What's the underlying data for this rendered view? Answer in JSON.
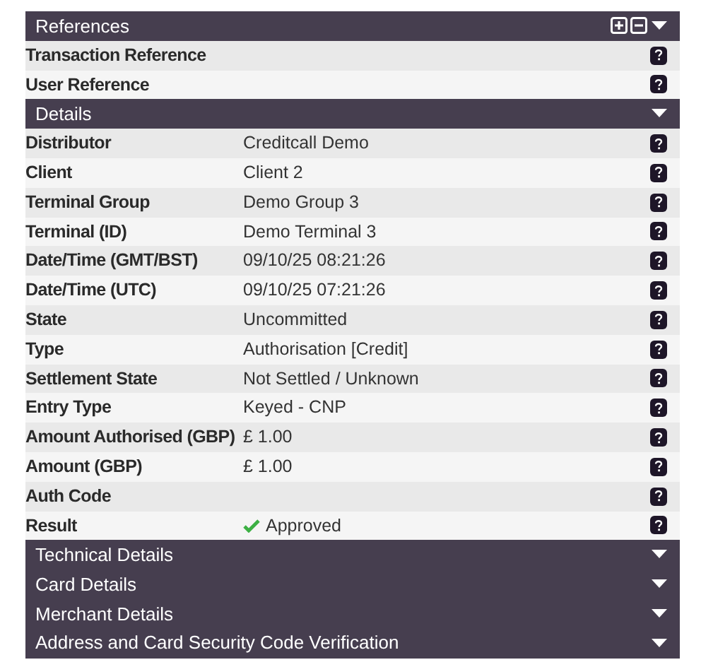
{
  "sections": [
    {
      "title": "References",
      "expanded": true,
      "expand_collapse_all": true,
      "rows": [
        {
          "label": "Transaction Reference",
          "kind": "text"
        },
        {
          "label": "User Reference",
          "kind": "text"
        }
      ]
    },
    {
      "title": "Details",
      "expanded": true,
      "rows": [
        {
          "label": "Distributor",
          "value": "Creditcall Demo",
          "kind": "text"
        },
        {
          "label": "Client",
          "value": "Client 2",
          "kind": "text"
        },
        {
          "label": "Terminal Group",
          "value": "Demo Group 3",
          "kind": "text"
        },
        {
          "label": "Terminal (ID)",
          "value": "Demo Terminal 3",
          "kind": "text"
        },
        {
          "label": "Date/Time (GMT/BST)",
          "value": "09/10/25 08:21:26",
          "kind": "text"
        },
        {
          "label": "Date/Time (UTC)",
          "value": "09/10/25 07:21:26",
          "kind": "text"
        },
        {
          "label": "State",
          "value": "Uncommitted",
          "kind": "text"
        },
        {
          "label": "Type",
          "value": "Authorisation [Credit]",
          "kind": "text"
        },
        {
          "label": "Settlement State",
          "value": "Not Settled / Unknown",
          "kind": "text"
        },
        {
          "label": "Entry Type",
          "value": "Keyed - CNP",
          "kind": "text"
        },
        {
          "label": "Amount Authorised (GBP)",
          "value": "£ 1.00",
          "kind": "text"
        },
        {
          "label": "Amount (GBP)",
          "value": "£ 1.00",
          "kind": "text"
        },
        {
          "label": "Auth Code",
          "kind": "text"
        },
        {
          "label": "Result",
          "value": "Approved",
          "kind": "success"
        }
      ]
    },
    {
      "title": "Technical Details",
      "expanded": false
    },
    {
      "title": "Card Details",
      "expanded": false
    },
    {
      "title": "Merchant Details",
      "expanded": false
    },
    {
      "title": "Address and Card Security Code Verification",
      "expanded": false
    }
  ]
}
